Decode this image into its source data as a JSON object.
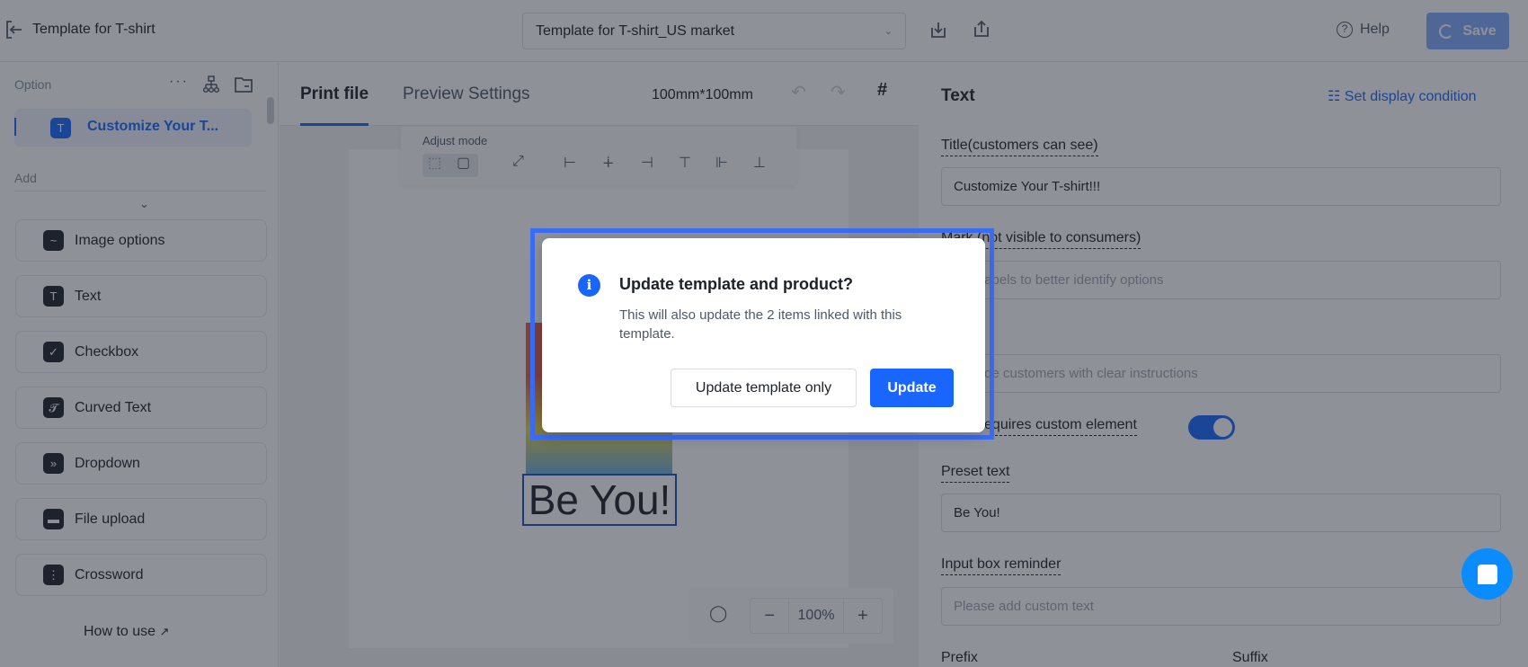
{
  "header": {
    "title": "Template for T-shirt",
    "template_select": "Template for T-shirt_US market",
    "help": "Help",
    "save": "Save"
  },
  "left": {
    "option_label": "Option",
    "selected_option": "Customize Your T...",
    "add_label": "Add",
    "items": [
      {
        "label": "Image options",
        "icon": "image-icon"
      },
      {
        "label": "Text",
        "icon": "text-icon"
      },
      {
        "label": "Checkbox",
        "icon": "checkbox-icon"
      },
      {
        "label": "Curved Text",
        "icon": "curved-text-icon"
      },
      {
        "label": "Dropdown",
        "icon": "dropdown-icon"
      },
      {
        "label": "File upload",
        "icon": "folder-icon"
      },
      {
        "label": "Crossword",
        "icon": "crossword-icon"
      }
    ],
    "how_to_use": "How to use"
  },
  "canvas": {
    "tabs": [
      "Print file",
      "Preview Settings"
    ],
    "size": "100mm*100mm",
    "adjust_mode": "Adjust mode",
    "text_on_canvas": "Be You!",
    "zoom": "100%"
  },
  "right": {
    "heading": "Text",
    "display_condition": "Set display condition",
    "title_label": "Title(customers can see)",
    "title_value": "Customize Your T-shirt!!!",
    "mark_label": "Mark (not visible to consumers)",
    "mark_placeholder": "Add labels to better identify options",
    "desc_placeholder": "Provide customers with clear instructions",
    "requires_label": "Logic requires custom element",
    "preset_label": "Preset text",
    "preset_value": "Be You!",
    "reminder_label": "Input box reminder",
    "reminder_placeholder": "Please add custom text",
    "prefix_label": "Prefix",
    "suffix_label": "Suffix"
  },
  "dialog": {
    "title": "Update template and product?",
    "message": "This will also update the 2 items linked with this template.",
    "secondary": "Update template only",
    "primary": "Update"
  },
  "colors": {
    "accent": "#1966ff",
    "highlight": "#3b6cf6"
  }
}
